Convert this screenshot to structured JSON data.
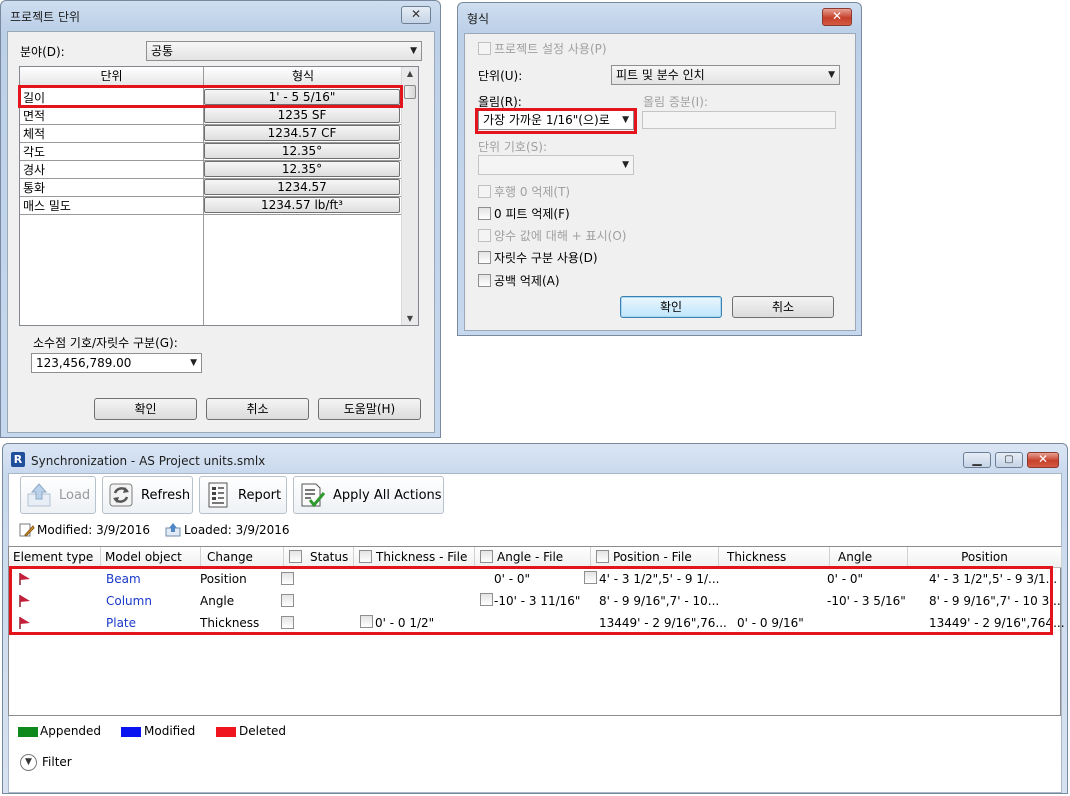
{
  "project_units": {
    "title": "프로젝트 단위",
    "discipline_label": "분야(D):",
    "discipline_value": "공통",
    "columns": [
      "단위",
      "형식"
    ],
    "rows": [
      {
        "unit": "길이",
        "format": "1' - 5 5/16\""
      },
      {
        "unit": "면적",
        "format": "1235 SF"
      },
      {
        "unit": "체적",
        "format": "1234.57 CF"
      },
      {
        "unit": "각도",
        "format": "12.35°"
      },
      {
        "unit": "경사",
        "format": "12.35°"
      },
      {
        "unit": "통화",
        "format": "1234.57"
      },
      {
        "unit": "매스 밀도",
        "format": "1234.57 lb/ft³"
      }
    ],
    "decimal_label": "소수점 기호/자릿수 구분(G):",
    "decimal_value": "123,456,789.00",
    "ok": "확인",
    "cancel": "취소",
    "help": "도움말(H)"
  },
  "format": {
    "title": "형식",
    "use_project": "프로젝트 설정 사용(P)",
    "units_label": "단위(U):",
    "units_value": "피트 및 분수 인치",
    "rounding_label": "올림(R):",
    "rounding_value": "가장 가까운 1/16\"(으)로",
    "rounding_inc_label": "올림 증분(I):",
    "unit_symbol_label": "단위 기호(S):",
    "opt_trailing": "후행 0 억제(T)",
    "opt_zero_feet": "0 피트 억제(F)",
    "opt_plus": "양수 값에 대해 + 표시(O)",
    "opt_digit_grouping": "자릿수 구분 사용(D)",
    "opt_spaces": "공백 억제(A)",
    "ok": "확인",
    "cancel": "취소"
  },
  "sync": {
    "title": "Synchronization - AS Project units.smlx",
    "toolbar": {
      "load": "Load",
      "refresh": "Refresh",
      "report": "Report",
      "apply": "Apply All Actions"
    },
    "modified": "Modified: 3/9/2016",
    "loaded": "Loaded: 3/9/2016",
    "columns": [
      "Element type",
      "Model object",
      "Change",
      "Status",
      "Thickness - File",
      "Angle - File",
      "Position - File",
      "Thickness",
      "Angle",
      "Position"
    ],
    "rows": [
      {
        "object": "Beam",
        "change": "Position",
        "thickness_file": "",
        "angle_file": "0' - 0\"",
        "position_file": "4' - 3 1/2\",5' - 9 1/...",
        "thickness": "",
        "angle": "0' - 0\"",
        "position": "4' - 3 1/2\",5' - 9 3/1..."
      },
      {
        "object": "Column",
        "change": "Angle",
        "thickness_file": "",
        "angle_file": "-10' - 3 11/16\"",
        "position_file": "8' - 9 9/16\",7' - 10...",
        "thickness": "",
        "angle": "-10' - 3 5/16\"",
        "position": "8' - 9 9/16\",7' - 10 3..."
      },
      {
        "object": "Plate",
        "change": "Thickness",
        "thickness_file": "0' - 0 1/2\"",
        "angle_file": "",
        "position_file": "13449' - 2 9/16\",76...",
        "thickness": "0' - 0 9/16\"",
        "angle": "",
        "position": "13449' - 2 9/16\",764..."
      }
    ],
    "legend": [
      {
        "label": "Appended",
        "color": "#0e8a1c"
      },
      {
        "label": "Modified",
        "color": "#0a14f0"
      },
      {
        "label": "Deleted",
        "color": "#f0141e"
      }
    ],
    "filter": "Filter"
  }
}
